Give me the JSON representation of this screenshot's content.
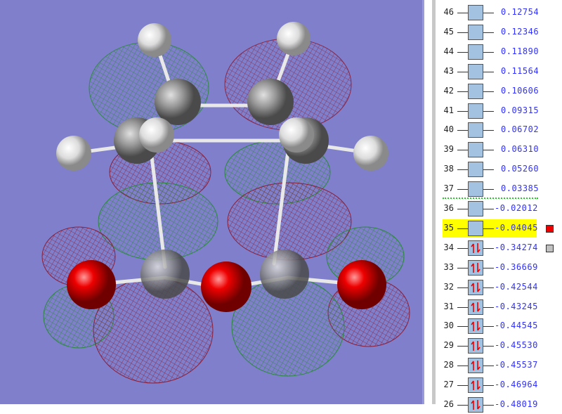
{
  "orbitals": [
    {
      "index": "46",
      "energy": "0.12754",
      "occupied": false
    },
    {
      "index": "45",
      "energy": "0.12346",
      "occupied": false
    },
    {
      "index": "44",
      "energy": "0.11890",
      "occupied": false
    },
    {
      "index": "43",
      "energy": "0.11564",
      "occupied": false
    },
    {
      "index": "42",
      "energy": "0.10606",
      "occupied": false
    },
    {
      "index": "41",
      "energy": "0.09315",
      "occupied": false
    },
    {
      "index": "40",
      "energy": "0.06702",
      "occupied": false
    },
    {
      "index": "39",
      "energy": "0.06310",
      "occupied": false
    },
    {
      "index": "38",
      "energy": "0.05260",
      "occupied": false
    },
    {
      "index": "37",
      "energy": "0.03385",
      "occupied": false
    },
    {
      "index": "36",
      "energy": "-0.02012",
      "occupied": false
    },
    {
      "index": "35",
      "energy": "-0.04045",
      "occupied": false,
      "selected": true,
      "marker": "#ee0000"
    },
    {
      "index": "34",
      "energy": "-0.34274",
      "occupied": true,
      "marker": "#c0c0c0"
    },
    {
      "index": "33",
      "energy": "-0.36669",
      "occupied": true
    },
    {
      "index": "32",
      "energy": "-0.42544",
      "occupied": true
    },
    {
      "index": "31",
      "energy": "-0.43245",
      "occupied": true
    },
    {
      "index": "30",
      "energy": "-0.44545",
      "occupied": true
    },
    {
      "index": "29",
      "energy": "-0.45530",
      "occupied": true
    },
    {
      "index": "28",
      "energy": "-0.45537",
      "occupied": true
    },
    {
      "index": "27",
      "energy": "-0.46964",
      "occupied": true
    },
    {
      "index": "26",
      "energy": "-0.48019",
      "occupied": true
    }
  ],
  "colors": {
    "background": "#7f7fcb",
    "positive_lobe": "#2a8a3a",
    "negative_lobe": "#8a1f3a",
    "oxygen": "#ee0000",
    "carbon": "#9a9a9a",
    "hydrogen": "#e8e8e8",
    "energy_text": "#3030ff",
    "highlight": "#ffff00"
  }
}
